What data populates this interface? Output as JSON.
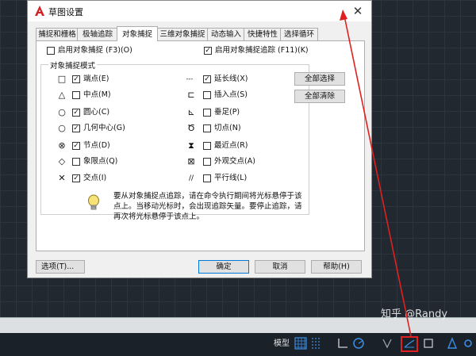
{
  "dialog": {
    "title": "草图设置",
    "tabs": [
      "捕捉和栅格",
      "极轴追踪",
      "对象捕捉",
      "三维对象捕捉",
      "动态输入",
      "快捷特性",
      "选择循环"
    ],
    "active_tab": "对象捕捉",
    "osnap_on": {
      "label": "启用对象捕捉 (F3)(O)",
      "checked": false
    },
    "otrack_on": {
      "label": "启用对象捕捉追踪 (F11)(K)",
      "checked": true
    },
    "group_title": "对象捕捉模式",
    "left_modes": [
      {
        "symbol": "□",
        "label": "端点(E)",
        "checked": true
      },
      {
        "symbol": "△",
        "label": "中点(M)",
        "checked": false
      },
      {
        "symbol": "○",
        "label": "圆心(C)",
        "checked": true
      },
      {
        "symbol": "○",
        "label": "几何中心(G)",
        "checked": true
      },
      {
        "symbol": "⊗",
        "label": "节点(D)",
        "checked": true
      },
      {
        "symbol": "◇",
        "label": "象限点(Q)",
        "checked": false
      },
      {
        "symbol": "✕",
        "label": "交点(I)",
        "checked": true
      }
    ],
    "right_modes": [
      {
        "symbol": "---",
        "label": "延长线(X)",
        "checked": true
      },
      {
        "symbol": "⊏",
        "label": "插入点(S)",
        "checked": false
      },
      {
        "symbol": "⊾",
        "label": "垂足(P)",
        "checked": false
      },
      {
        "symbol": "Ծ",
        "label": "切点(N)",
        "checked": false
      },
      {
        "symbol": "⧗",
        "label": "最近点(R)",
        "checked": false
      },
      {
        "symbol": "⊠",
        "label": "外观交点(A)",
        "checked": false
      },
      {
        "symbol": "//",
        "label": "平行线(L)",
        "checked": false
      }
    ],
    "select_all": "全部选择",
    "clear_all": "全部清除",
    "hint": "要从对象捕捉点追踪，请在命令执行期间将光标悬停于该点上。当移动光标时，会出现追踪矢量。要停止追踪，请再次将光标悬停于该点上。",
    "options_button": "选项(T)...",
    "ok_button": "确定",
    "cancel_button": "取消",
    "help_button": "帮助(H)"
  },
  "statusbar": {
    "model_label": "模型"
  },
  "watermark": "知乎 @Randy",
  "colors": {
    "canvas": "#212830",
    "accent": "#0078d7",
    "highlight": "#e02020"
  }
}
